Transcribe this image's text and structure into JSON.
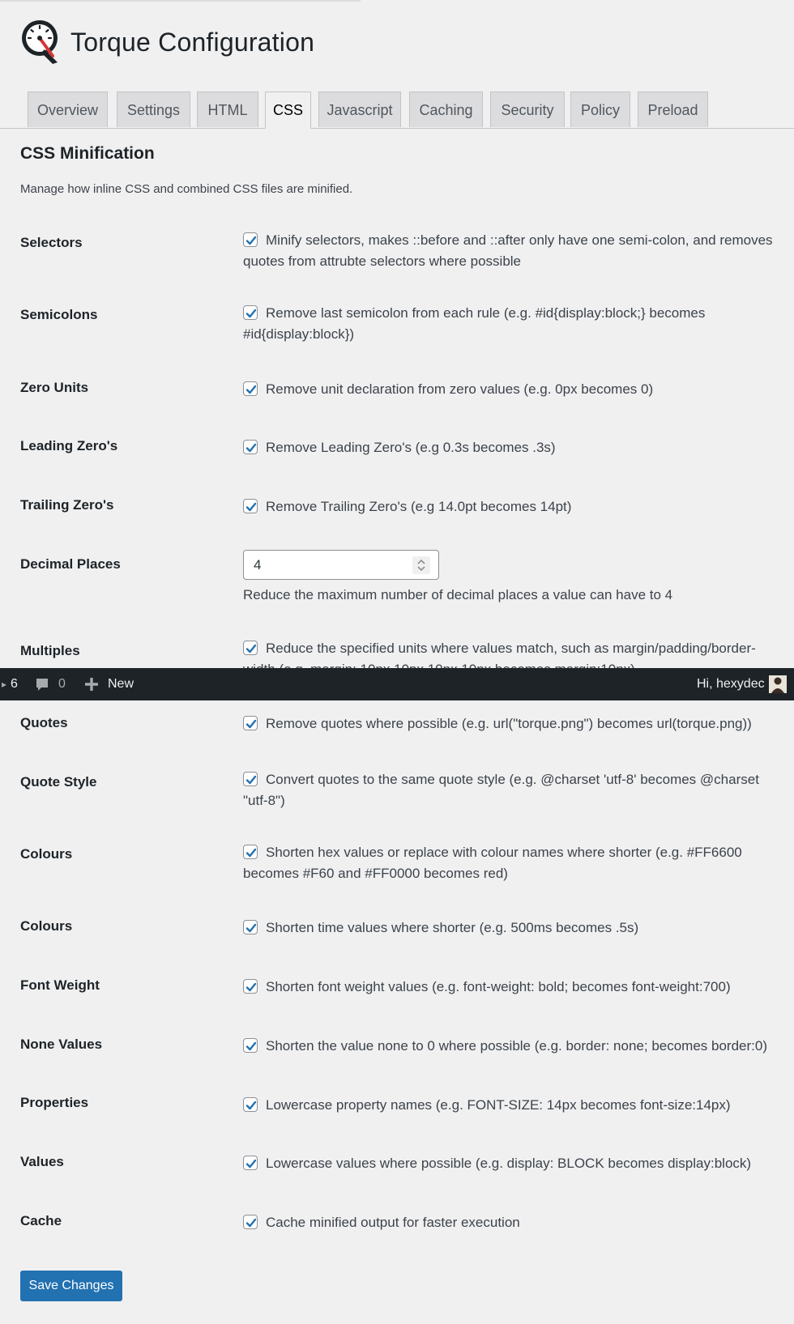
{
  "page": {
    "title": "Torque Configuration"
  },
  "tabs": [
    {
      "label": "Overview"
    },
    {
      "label": "Settings"
    },
    {
      "label": "HTML"
    },
    {
      "label": "CSS"
    },
    {
      "label": "Javascript"
    },
    {
      "label": "Caching"
    },
    {
      "label": "Security"
    },
    {
      "label": "Policy"
    },
    {
      "label": "Preload"
    }
  ],
  "section": {
    "title": "CSS Minification",
    "description": "Manage how inline CSS and combined CSS files are minified."
  },
  "rows": [
    {
      "label": "Selectors",
      "text": "Minify selectors, makes ::before and ::after only have one semi-colon, and removes quotes from attrubte selectors where possible",
      "checked": true
    },
    {
      "label": "Semicolons",
      "text": "Remove last semicolon from each rule (e.g. #id{display:block;} becomes #id{display:block})",
      "checked": true
    },
    {
      "label": "Zero Units",
      "text": "Remove unit declaration from zero values (e.g. 0px becomes 0)",
      "checked": true
    },
    {
      "label": "Leading Zero's",
      "text": "Remove Leading Zero's (e.g 0.3s becomes .3s)",
      "checked": true
    },
    {
      "label": "Trailing Zero's",
      "text": "Remove Trailing Zero's (e.g 14.0pt becomes 14pt)",
      "checked": true
    },
    {
      "label": "Decimal Places",
      "value": "4",
      "help": "Reduce the maximum number of decimal places a value can have to 4"
    },
    {
      "label": "Multiples",
      "text": "Reduce the specified units where values match, such as margin/padding/border-width (e.g. margin: 10px 10px 10px 10px becomes margin:10px)",
      "checked": true
    },
    {
      "label": "Quotes",
      "text": "Remove quotes where possible (e.g. url(\"torque.png\") becomes url(torque.png))",
      "checked": true
    },
    {
      "label": "Quote Style",
      "text": "Convert quotes to the same quote style (e.g. @charset 'utf-8' becomes @charset \"utf-8\")",
      "checked": true
    },
    {
      "label": "Colours",
      "text": "Shorten hex values or replace with colour names where shorter (e.g. #FF6600 becomes #F60 and #FF0000 becomes red)",
      "checked": true
    },
    {
      "label": "Colours",
      "text": "Shorten time values where shorter (e.g. 500ms becomes .5s)",
      "checked": true
    },
    {
      "label": "Font Weight",
      "text": "Shorten font weight values (e.g. font-weight: bold; becomes font-weight:700)",
      "checked": true
    },
    {
      "label": "None Values",
      "text": "Shorten the value none to 0 where possible (e.g. border: none; becomes border:0)",
      "checked": true
    },
    {
      "label": "Properties",
      "text": "Lowercase property names (e.g. FONT-SIZE: 14px becomes font-size:14px)",
      "checked": true
    },
    {
      "label": "Values",
      "text": "Lowercase values where possible (e.g. display: BLOCK becomes display:block)",
      "checked": true
    },
    {
      "label": "Cache",
      "text": "Cache minified output for faster execution",
      "checked": true
    }
  ],
  "adminbar": {
    "updates_count": "6",
    "comments_count": "0",
    "new_label": "New",
    "greeting": "Hi, hexydec"
  },
  "save_button": "Save Changes",
  "colors": {
    "accent": "#2271b1",
    "adminbar": "#1d2327"
  }
}
